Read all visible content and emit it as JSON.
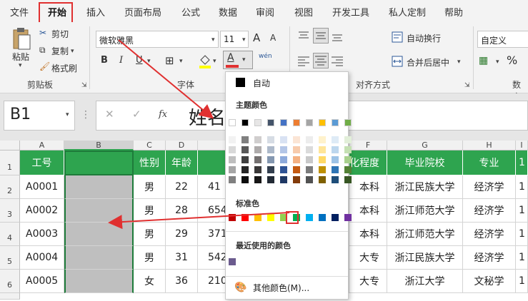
{
  "menu": [
    "文件",
    "开始",
    "插入",
    "页面布局",
    "公式",
    "数据",
    "审阅",
    "视图",
    "开发工具",
    "私人定制",
    "帮助"
  ],
  "ribbon": {
    "paste": "粘贴",
    "cut": "剪切",
    "copy": "复制",
    "format_painter": "格式刷",
    "clipboard_label": "剪贴板",
    "font_name": "微软雅黑",
    "font_size": "11",
    "font_label": "字体",
    "bold": "B",
    "italic": "I",
    "underline": "U",
    "font_color_letter": "A",
    "wen": "wén",
    "align_label": "对齐方式",
    "wrap_text": "自动换行",
    "merge_center": "合并后居中",
    "number_format": "自定义",
    "number_label": "数字",
    "percent": "%",
    "grow_font": "A",
    "shrink_font": "A"
  },
  "formula_bar": {
    "name_box": "B1",
    "fx": "fx",
    "content": "姓名"
  },
  "columns": [
    "A",
    "B",
    "C",
    "D",
    "",
    "F",
    "G",
    "H",
    "I"
  ],
  "rows": [
    "1",
    "2",
    "3",
    "4",
    "5",
    "6"
  ],
  "table": {
    "header": [
      "工号",
      "",
      "性别",
      "年龄",
      "",
      "化程度",
      "毕业院校",
      "专业",
      "1"
    ],
    "rows": [
      [
        "A0001",
        "",
        "男",
        "22",
        "41",
        "本科",
        "浙江民族大学",
        "经济学",
        "1"
      ],
      [
        "A0002",
        "",
        "男",
        "28",
        "654",
        "本科",
        "浙江师范大学",
        "经济学",
        "1"
      ],
      [
        "A0003",
        "",
        "男",
        "29",
        "371",
        "本科",
        "浙江师范大学",
        "经济学",
        "1"
      ],
      [
        "A0004",
        "",
        "男",
        "31",
        "542",
        "大专",
        "浙江民族大学",
        "经济学",
        "1"
      ],
      [
        "A0005",
        "",
        "女",
        "36",
        "210",
        "大专",
        "浙江大学",
        "文秘学",
        "1"
      ]
    ]
  },
  "palette": {
    "auto": "自动",
    "theme_title": "主题颜色",
    "standard_title": "标准色",
    "recent_title": "最近使用的颜色",
    "more_colors": "其他颜色(M)...",
    "theme_top": [
      "#ffffff",
      "#000000",
      "#e7e6e6",
      "#44546a",
      "#4472c4",
      "#ed7d31",
      "#a5a5a5",
      "#ffc000",
      "#5b9bd5",
      "#70ad47"
    ],
    "theme_shades": [
      [
        "#f2f2f2",
        "#d9d9d9",
        "#bfbfbf",
        "#a6a6a6",
        "#808080"
      ],
      [
        "#808080",
        "#595959",
        "#404040",
        "#262626",
        "#0d0d0d"
      ],
      [
        "#d0cece",
        "#aeabab",
        "#757171",
        "#3a3838",
        "#171616"
      ],
      [
        "#d6dce4",
        "#adb9ca",
        "#8497b0",
        "#333f4f",
        "#222a35"
      ],
      [
        "#d9e2f3",
        "#b4c6e7",
        "#8eaadb",
        "#2f5496",
        "#1f3864"
      ],
      [
        "#fbe5d5",
        "#f7cbac",
        "#f4b183",
        "#c55a11",
        "#833c0b"
      ],
      [
        "#ededed",
        "#dbdbdb",
        "#c9c9c9",
        "#7b7b7b",
        "#525252"
      ],
      [
        "#fff2cc",
        "#ffe599",
        "#ffd966",
        "#bf9000",
        "#7f6000"
      ],
      [
        "#deebf6",
        "#bdd7ee",
        "#9dc3e6",
        "#2e75b5",
        "#1e4e79"
      ],
      [
        "#e2efd9",
        "#c5e0b3",
        "#a8d08d",
        "#538135",
        "#375623"
      ]
    ],
    "standard": [
      "#c00000",
      "#ff0000",
      "#ffc000",
      "#ffff00",
      "#92d050",
      "#00b050",
      "#00b0f0",
      "#0070c0",
      "#002060",
      "#7030a0"
    ],
    "recent": [
      "#6b5b8e"
    ]
  },
  "colors": {
    "accent_red": "#e03030",
    "header_green": "#2ea44f",
    "selection_gray": "#bfbfbf"
  }
}
